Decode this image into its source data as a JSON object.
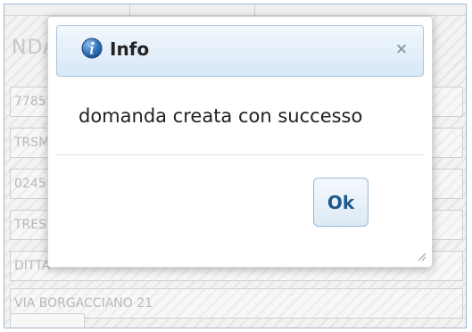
{
  "background": {
    "heading": "NDA",
    "fields": [
      {
        "value": "77852"
      },
      {
        "value": "TRSM"
      },
      {
        "value": "02458"
      },
      {
        "value": "TRES"
      },
      {
        "value": "DITTA "
      },
      {
        "value": "VIA BORGACCIANO 21"
      }
    ]
  },
  "dialog": {
    "title": "Info",
    "message": "domanda creata con successo",
    "close_glyph": "×",
    "ok_label": "Ok"
  },
  "colors": {
    "accent": "#1f5a8c",
    "titlebar_border": "#a9c6e0"
  },
  "icons": [
    "info-icon",
    "close-icon",
    "resize-grip-icon"
  ]
}
